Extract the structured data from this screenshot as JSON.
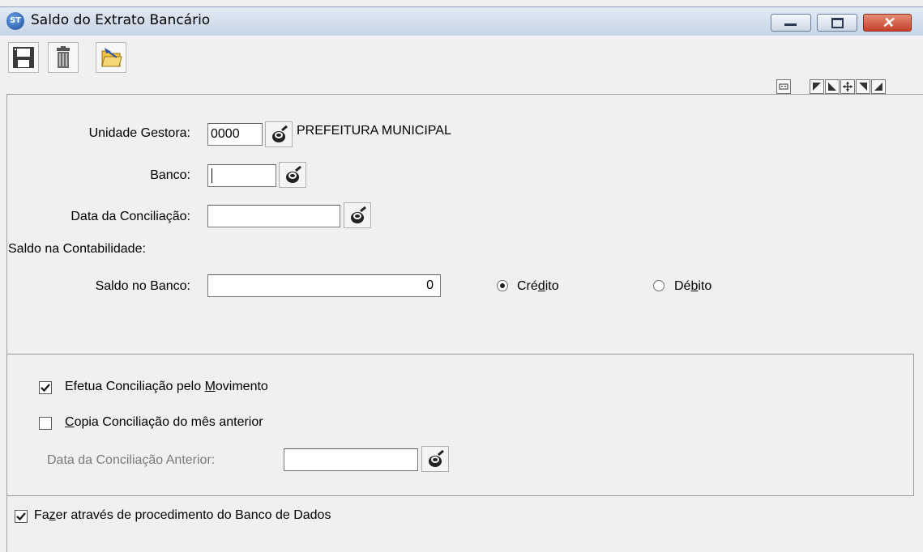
{
  "window": {
    "title": "Saldo do Extrato Bancário",
    "app_icon_text": "ST",
    "close_glyph": "✕"
  },
  "toolbar": {
    "buttons": [
      {
        "name": "save",
        "icon": "floppy-disk-icon"
      },
      {
        "name": "delete",
        "icon": "trash-icon"
      },
      {
        "name": "open",
        "icon": "folder-arrow-icon"
      }
    ],
    "status_icons": [
      "keyboard-icon",
      "corner-top-left-icon",
      "corner-bottom-left-icon",
      "move-icon",
      "corner-top-right-icon",
      "corner-bottom-right-icon"
    ]
  },
  "form": {
    "unidade_gestora": {
      "label": "Unidade Gestora:",
      "value": "0000",
      "description": "PREFEITURA MUNICIPAL"
    },
    "banco": {
      "label": "Banco:",
      "value": ""
    },
    "data_conciliacao": {
      "label": "Data da Conciliação:",
      "value": ""
    },
    "saldo_contabilidade": {
      "label": "Saldo na Contabilidade:"
    },
    "saldo_banco": {
      "label": "Saldo no Banco:",
      "value": "0"
    },
    "tipo_saldo": {
      "options": [
        {
          "pre": "Cré",
          "accel": "d",
          "post": "ito",
          "selected": true
        },
        {
          "pre": "Dé",
          "accel": "b",
          "post": "ito",
          "selected": false
        }
      ]
    },
    "efetua_conciliacao": {
      "pre": "Efetua Conciliação pelo ",
      "accel": "M",
      "post": "ovimento",
      "checked": true
    },
    "copia_conciliacao": {
      "pre": "",
      "accel": "C",
      "post": "opia Conciliação do mês anterior",
      "checked": false
    },
    "data_conciliacao_anterior": {
      "label": "Data da Conciliação Anterior:",
      "value": "",
      "disabled": true
    },
    "fazer_procedimento": {
      "pre": "Fa",
      "accel": "z",
      "post": "er através de procedimento do Banco de Dados",
      "checked": true
    }
  }
}
